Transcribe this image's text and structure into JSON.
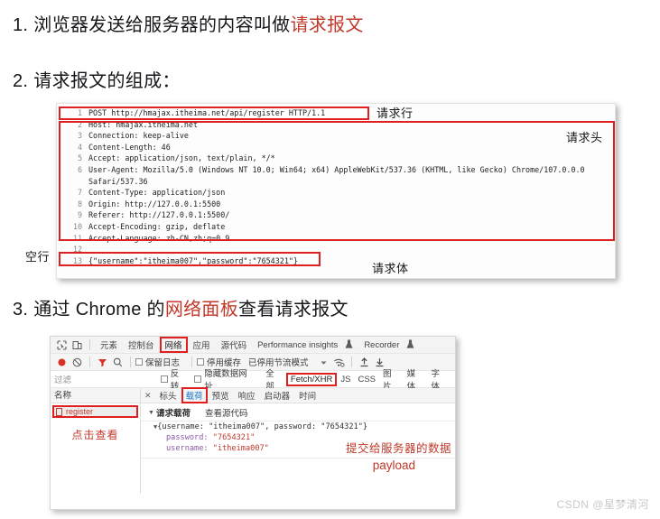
{
  "headings": [
    {
      "num": "1.",
      "pre": "浏览器发送给服务器的内容叫做",
      "highlight": "请求报文",
      "post": ""
    },
    {
      "num": "2.",
      "pre": "请求报文的组成：",
      "highlight": "",
      "post": ""
    },
    {
      "num": "3.",
      "pre": "通过 Chrome 的",
      "highlight": "网络面板",
      "post": "查看请求报文"
    }
  ],
  "request_message": {
    "lines": [
      {
        "no": "1",
        "text": "POST http://hmajax.itheima.net/api/register HTTP/1.1"
      },
      {
        "no": "2",
        "text": "Host: hmajax.itheima.net"
      },
      {
        "no": "3",
        "text": "Connection: keep-alive"
      },
      {
        "no": "4",
        "text": "Content-Length: 46"
      },
      {
        "no": "5",
        "text": "Accept: application/json, text/plain, */*"
      },
      {
        "no": "6",
        "text": "User-Agent: Mozilla/5.0 (Windows NT 10.0; Win64; x64) AppleWebKit/537.36 (KHTML, like Gecko) Chrome/107.0.0.0",
        "cont": "Safari/537.36"
      },
      {
        "no": "7",
        "text": "Content-Type: application/json"
      },
      {
        "no": "8",
        "text": "Origin: http://127.0.0.1:5500"
      },
      {
        "no": "9",
        "text": "Referer: http://127.0.0.1:5500/"
      },
      {
        "no": "10",
        "text": "Accept-Encoding: gzip, deflate"
      },
      {
        "no": "11",
        "text": "Accept-Language: zh-CN,zh;q=0.9"
      },
      {
        "no": "12",
        "text": ""
      },
      {
        "no": "13",
        "text": "{\"username\":\"itheima007\",\"password\":\"7654321\"}"
      }
    ],
    "annotations": {
      "request_line": "请求行",
      "request_headers": "请求头",
      "request_body": "请求体",
      "blank_line": "空行"
    }
  },
  "devtools": {
    "main_tabs": [
      "元素",
      "控制台",
      "网络",
      "应用",
      "源代码",
      "Performance insights",
      "Recorder"
    ],
    "selected_main_tab": "网络",
    "toolbar": {
      "preserve_log": "保留日志",
      "disable_cache": "停用缓存",
      "throttling": "已停用节流模式"
    },
    "filter": {
      "placeholder": "过滤",
      "invert": "反转",
      "hide_data_urls": "隐藏数据网址",
      "types": [
        "全部",
        "Fetch/XHR",
        "JS",
        "CSS",
        "图片",
        "媒体",
        "字体"
      ],
      "selected_type": "Fetch/XHR"
    },
    "requests": {
      "column_header": "名称",
      "items": [
        "register"
      ],
      "hint": "点击查看"
    },
    "detail_tabs": [
      "标头",
      "载荷",
      "预览",
      "响应",
      "启动器",
      "时间"
    ],
    "selected_detail_tab": "载荷",
    "payload": {
      "section_title": "请求载荷",
      "view_source": "查看源代码",
      "summary": "{username: \"itheima007\", password: \"7654321\"}",
      "rows": [
        {
          "key": "password:",
          "value": "\"7654321\""
        },
        {
          "key": "username:",
          "value": "\"itheima007\""
        }
      ],
      "annotation1": "提交给服务器的数据",
      "annotation2": "payload"
    }
  },
  "watermark": "CSDN @星梦清河",
  "colors": {
    "accent_red": "#c0392b",
    "box_red": "#e02020",
    "link_blue": "#1a73c9"
  }
}
